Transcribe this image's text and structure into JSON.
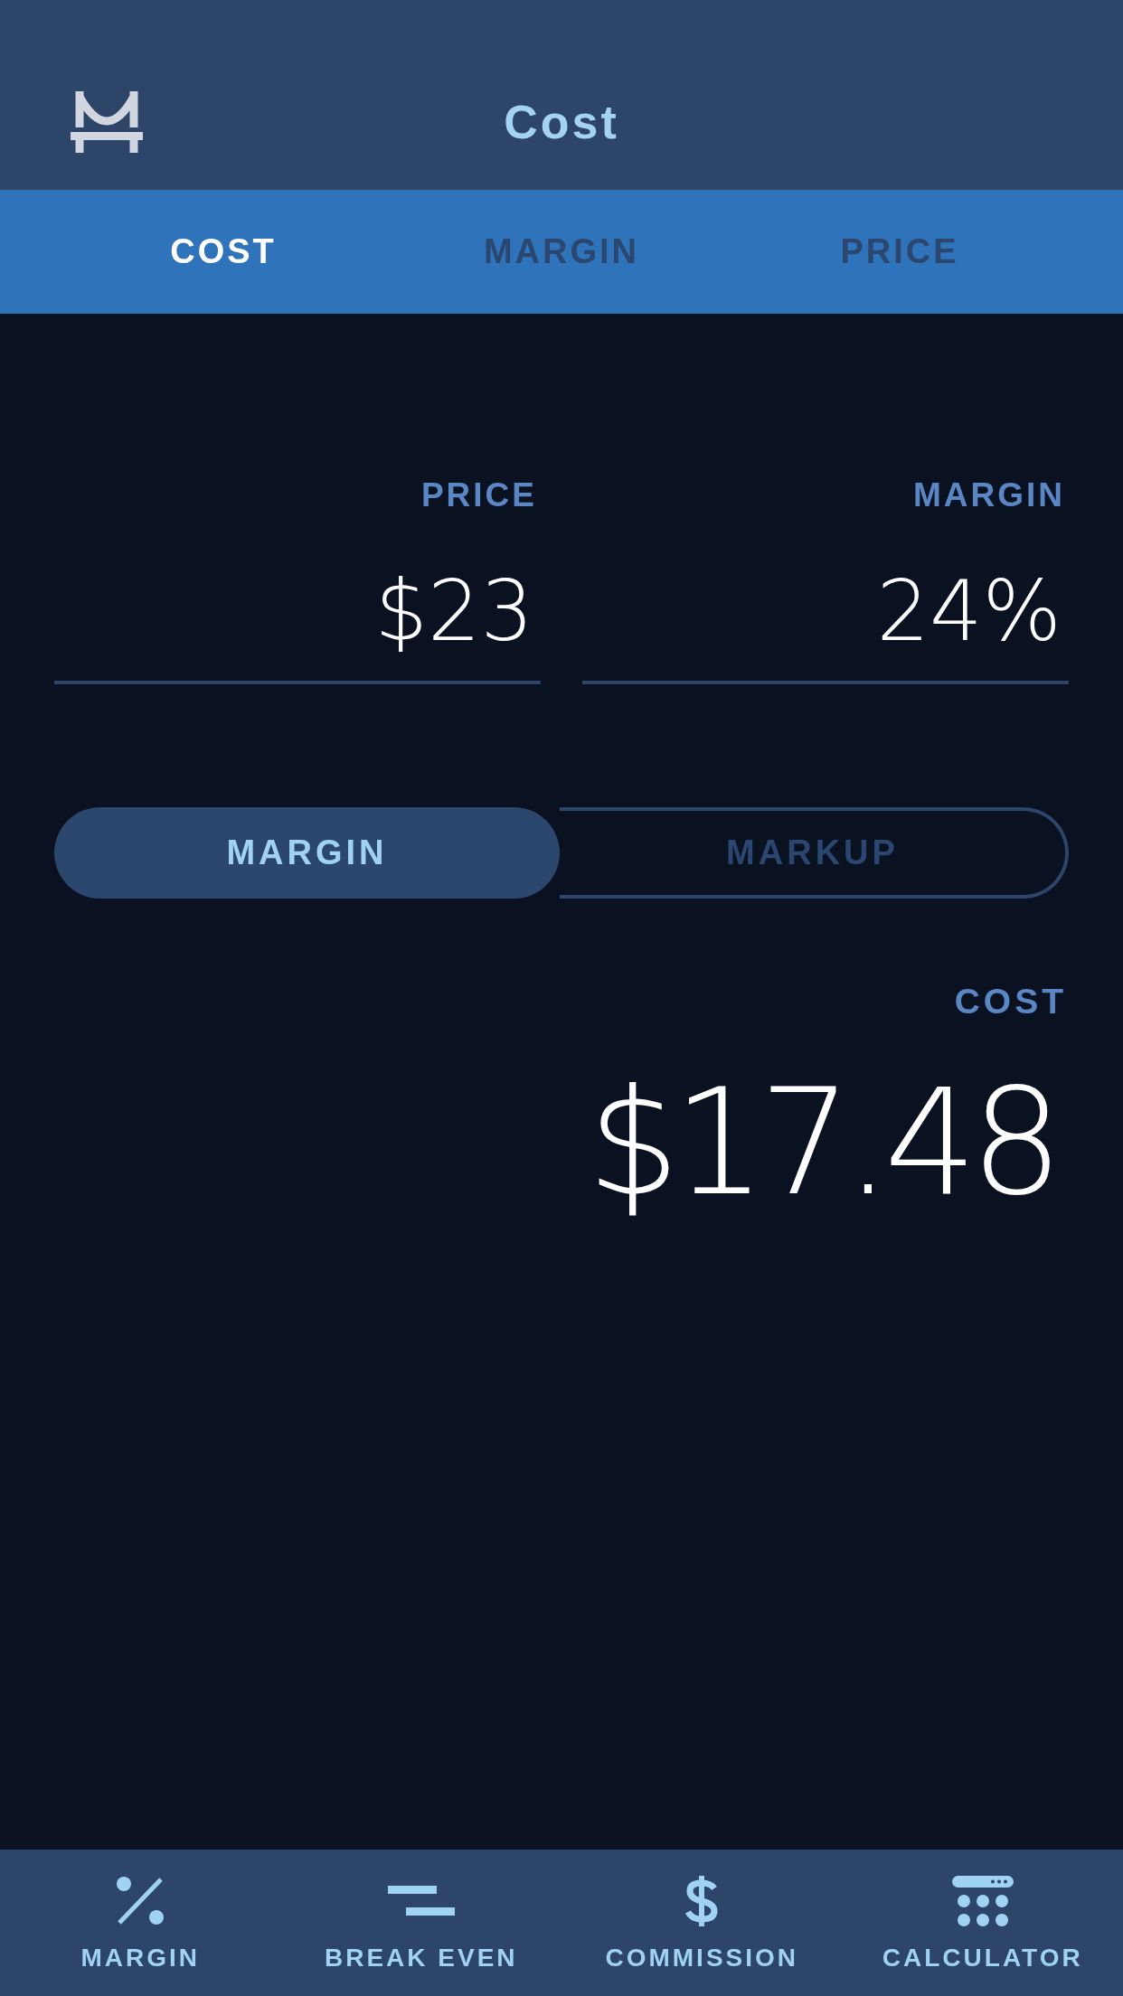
{
  "header": {
    "title": "Cost"
  },
  "tabs": [
    {
      "label": "COST",
      "selected": true
    },
    {
      "label": "MARGIN",
      "selected": false
    },
    {
      "label": "PRICE",
      "selected": false
    }
  ],
  "inputs": [
    {
      "label": "PRICE",
      "value": "$23"
    },
    {
      "label": "MARGIN",
      "value": "24%"
    }
  ],
  "mode_toggle": [
    {
      "label": "MARGIN",
      "selected": true
    },
    {
      "label": "MARKUP",
      "selected": false
    }
  ],
  "result": {
    "label": "COST",
    "value": "$17.48"
  },
  "bottom_nav": [
    {
      "kind": "percent",
      "label": "MARGIN"
    },
    {
      "kind": "break-even",
      "label": "BREAK EVEN"
    },
    {
      "kind": "dollar",
      "label": "COMMISSION"
    },
    {
      "kind": "calculator",
      "label": "CALCULATOR"
    }
  ]
}
